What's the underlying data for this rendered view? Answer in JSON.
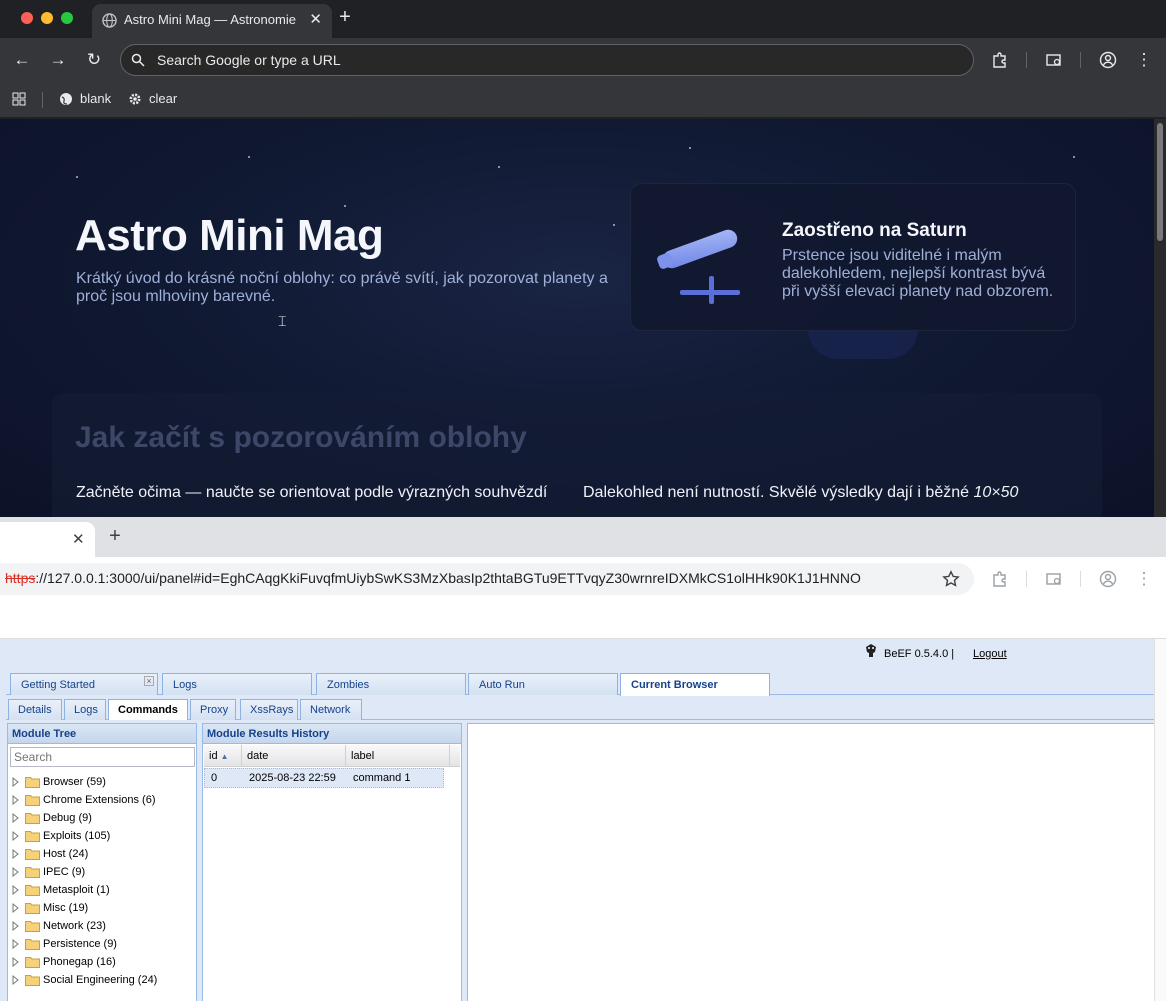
{
  "window1": {
    "tab_title": "Astro Mini Mag — Astronomie",
    "omnibox_placeholder": "Search Google or type a URL",
    "bookmarks": [
      "blank",
      "clear"
    ]
  },
  "astro": {
    "title": "Astro Mini Mag",
    "subtitle": "Krátký úvod do krásné noční oblohy: co právě svítí, jak pozorovat planety a proč jsou mlhoviny barevné.",
    "card_title": "Zaostřeno na Saturn",
    "card_text": "Prstence jsou viditelné i malým dalekohledem, nejlepší kontrast bývá při vyšší elevaci planety nad obzorem.",
    "section_title": "Jak začít s pozorováním oblohy",
    "col1_line1": "Začněte očima — naučte se orientovat podle výrazných souhvězdí",
    "col2_line1_a": "Dalekohled není nutností. Skvělé výsledky dají i běžné ",
    "col2_line1_b": "10×50"
  },
  "window2": {
    "url_scheme": "https",
    "url_rest": "://127.0.0.1:3000/ui/panel#id=EghCAqgKkiFuvqfmUiybSwKS3MzXbasIp2thtaBGTu9ETTvqyZ30wrnreIDXMkCS1olHHk90K1J1HNNO"
  },
  "beef": {
    "version": "BeEF  0.5.4.0  |",
    "logout": "Logout",
    "main_tabs": [
      "Getting Started",
      "Logs",
      "Zombies",
      "Auto Run",
      "Current Browser"
    ],
    "sub_tabs": [
      "Details",
      "Logs",
      "Commands",
      "Proxy",
      "XssRays",
      "Network"
    ],
    "module_tree": {
      "title": "Module Tree",
      "search_placeholder": "Search",
      "items": [
        "Browser (59)",
        "Chrome Extensions (6)",
        "Debug (9)",
        "Exploits (105)",
        "Host (24)",
        "IPEC (9)",
        "Metasploit (1)",
        "Misc (19)",
        "Network (23)",
        "Persistence (9)",
        "Phonegap (16)",
        "Social Engineering (24)"
      ]
    },
    "results": {
      "title": "Module Results History",
      "columns": [
        "id",
        "date",
        "label"
      ],
      "rows": [
        {
          "id": "0",
          "date": "2025-08-23 22:59",
          "label": "command 1"
        }
      ]
    }
  }
}
